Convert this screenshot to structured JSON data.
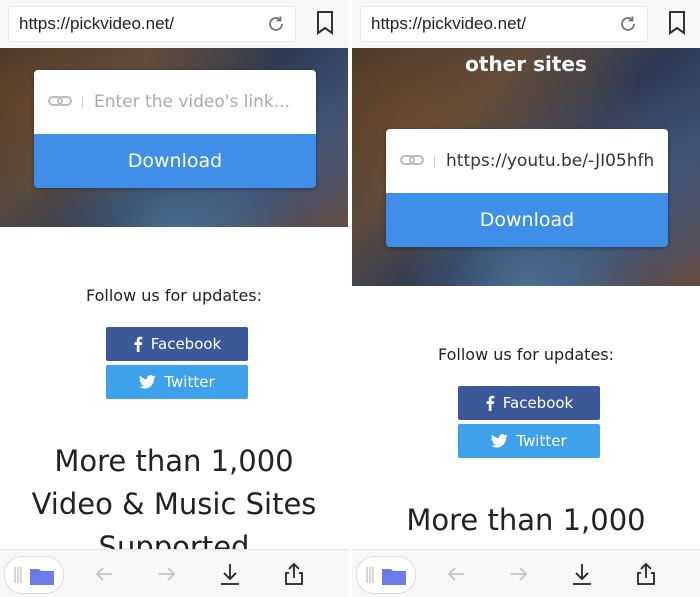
{
  "screens": [
    {
      "url": "https://pickvideo.net/",
      "hero_title": "",
      "input_placeholder": "Enter the video's link...",
      "input_value": "",
      "download_label": "Download",
      "follow_text": "Follow us for updates:",
      "facebook_label": "Facebook",
      "twitter_label": "Twitter",
      "big_lines": [
        "More than 1,000",
        "Video & Music Sites",
        "Supported"
      ]
    },
    {
      "url": "https://pickvideo.net/",
      "hero_title": "other sites",
      "input_placeholder": "",
      "input_value": "https://youtu.be/-JI05hfh",
      "download_label": "Download",
      "follow_text": "Follow us for updates:",
      "facebook_label": "Facebook",
      "twitter_label": "Twitter",
      "big_lines": [
        "More than 1,000"
      ]
    }
  ],
  "icons": {
    "reload": "reload-icon",
    "bookmark": "bookmark-icon",
    "link": "link-icon",
    "facebook": "facebook-icon",
    "twitter": "twitter-icon",
    "grip": "tab-grip-icon",
    "folder": "folder-icon",
    "back": "arrow-left-icon",
    "forward": "arrow-right-icon",
    "download": "download-icon",
    "share": "share-icon"
  },
  "colors": {
    "download_button": "#3f8ee8",
    "facebook": "#3b5998",
    "twitter": "#3ea1ec",
    "folder": "#6b7be8"
  }
}
